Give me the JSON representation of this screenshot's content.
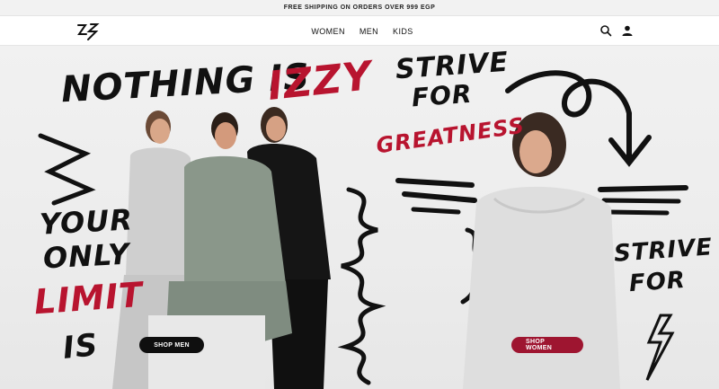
{
  "announcement": "FREE SHIPPING ON ORDERS OVER 999 EGP",
  "header": {
    "logo_icon": "zs-brand-logo",
    "nav": [
      {
        "label": "WOMEN"
      },
      {
        "label": "MEN"
      },
      {
        "label": "KIDS"
      }
    ],
    "icons": [
      "search-icon",
      "account-icon"
    ]
  },
  "hero": {
    "headline_a": "NOTHING IS",
    "headline_b": "IZZY",
    "strive_top_1": "STRIVE",
    "strive_top_2": "FOR",
    "greatness": "GREATNESS",
    "your": "YOUR",
    "only": "ONLY",
    "limit": "LIMIT",
    "is": "IS",
    "strive_right_1": "STRIVE",
    "strive_right_2": "FOR",
    "shop_men": "SHOP MEN",
    "shop_women": "SHOP WOMEN",
    "colors": {
      "accent_red": "#b8142f",
      "cta_women": "#9e1530",
      "ink": "#111111"
    }
  }
}
